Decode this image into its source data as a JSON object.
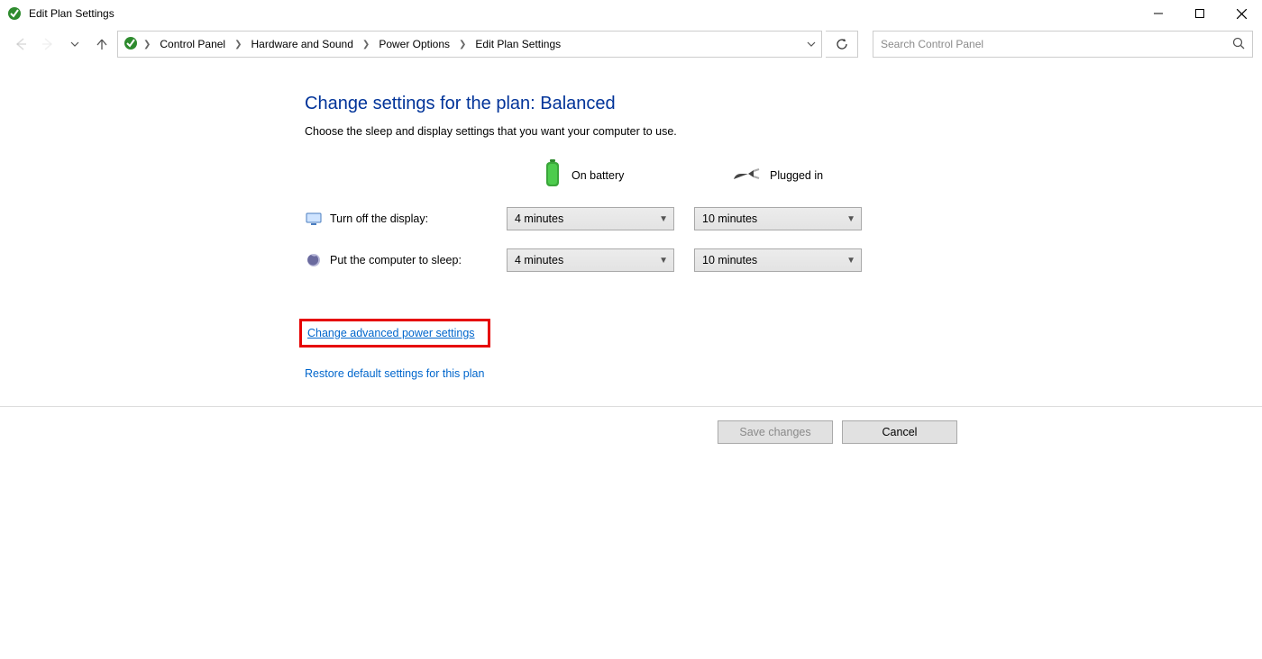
{
  "window": {
    "title": "Edit Plan Settings"
  },
  "breadcrumb": {
    "items": [
      "Control Panel",
      "Hardware and Sound",
      "Power Options",
      "Edit Plan Settings"
    ]
  },
  "search": {
    "placeholder": "Search Control Panel"
  },
  "main": {
    "heading": "Change settings for the plan: Balanced",
    "subtext": "Choose the sleep and display settings that you want your computer to use.",
    "columns": {
      "battery": "On battery",
      "plugged": "Plugged in"
    },
    "rows": {
      "display": {
        "label": "Turn off the display:",
        "battery_value": "4 minutes",
        "plugged_value": "10 minutes"
      },
      "sleep": {
        "label": "Put the computer to sleep:",
        "battery_value": "4 minutes",
        "plugged_value": "10 minutes"
      }
    },
    "advanced_link": "Change advanced power settings",
    "restore_link": "Restore default settings for this plan"
  },
  "buttons": {
    "save": "Save changes",
    "cancel": "Cancel"
  }
}
